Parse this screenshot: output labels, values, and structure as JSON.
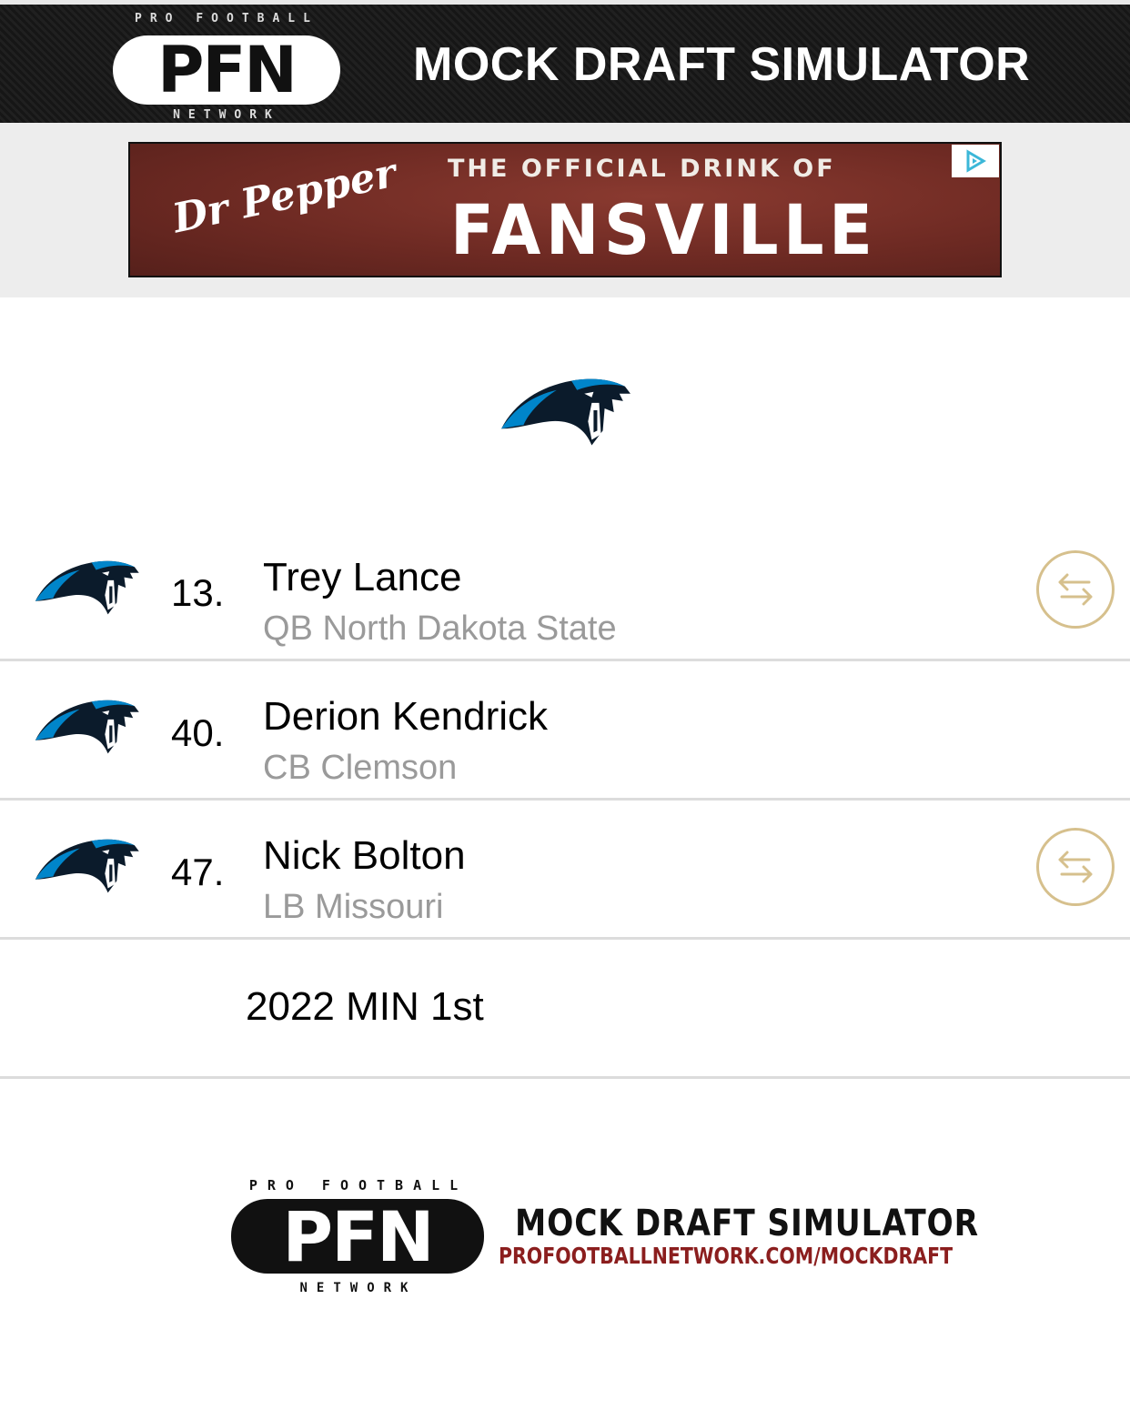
{
  "header": {
    "logo_top": "PRO FOOTBALL",
    "logo_mark": "PFN",
    "logo_bottom": "NETWORK",
    "title": "MOCK DRAFT SIMULATOR"
  },
  "ad": {
    "brand": "Dr Pepper",
    "line1": "THE OFFICIAL DRINK OF",
    "line2": "FANSVILLE",
    "choice_icon": "adchoices-icon"
  },
  "team": {
    "logo_icon": "panther-logo-icon",
    "accent": "#0085CA"
  },
  "picks": [
    {
      "number": "13.",
      "name": "Trey Lance",
      "info": "QB North Dakota State",
      "tradeable": true
    },
    {
      "number": "40.",
      "name": "Derion Kendrick",
      "info": "CB Clemson",
      "tradeable": false
    },
    {
      "number": "47.",
      "name": "Nick Bolton",
      "info": "LB Missouri",
      "tradeable": true
    }
  ],
  "future_picks": [
    "2022 MIN 1st"
  ],
  "footer": {
    "logo_top": "PRO FOOTBALL",
    "logo_mark": "PFN",
    "logo_bottom": "NETWORK",
    "title": "MOCK DRAFT SIMULATOR",
    "url": "PROFOOTBALLNETWORK.COM/MOCKDRAFT"
  },
  "colors": {
    "header_bg": "#1a1a1a",
    "trade_gold": "#d6c08d",
    "subtext_gray": "#9a9a9a",
    "url_red": "#8b1e1e"
  }
}
